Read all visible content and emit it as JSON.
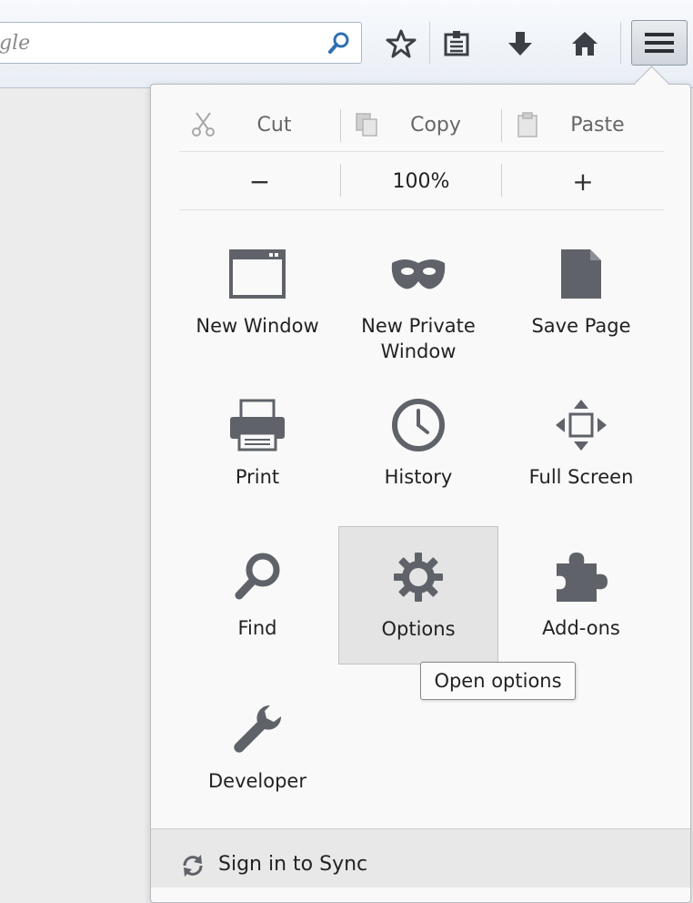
{
  "search": {
    "text": "gle"
  },
  "toolbar": {
    "buttons": [
      "bookmark-star-icon",
      "bookmarks-list-icon",
      "downloads-icon",
      "home-icon",
      "menu-icon"
    ]
  },
  "edit": {
    "cut": "Cut",
    "copy": "Copy",
    "paste": "Paste"
  },
  "zoom": {
    "minus": "−",
    "level": "100%",
    "plus": "+"
  },
  "grid": [
    {
      "label": "New Window",
      "icon": "window-icon"
    },
    {
      "label": "New Private Window",
      "icon": "mask-icon"
    },
    {
      "label": "Save Page",
      "icon": "page-icon"
    },
    {
      "label": "Print",
      "icon": "printer-icon"
    },
    {
      "label": "History",
      "icon": "clock-icon"
    },
    {
      "label": "Full Screen",
      "icon": "fullscreen-icon"
    },
    {
      "label": "Find",
      "icon": "magnifier-icon"
    },
    {
      "label": "Options",
      "icon": "gear-icon"
    },
    {
      "label": "Add-ons",
      "icon": "puzzle-icon"
    },
    {
      "label": "Developer",
      "icon": "wrench-icon"
    }
  ],
  "tooltip": "Open options",
  "footer": {
    "sync": "Sign in to Sync"
  },
  "colors": {
    "icon": "#5f6369",
    "accent_blue": "#2f6fb2"
  }
}
